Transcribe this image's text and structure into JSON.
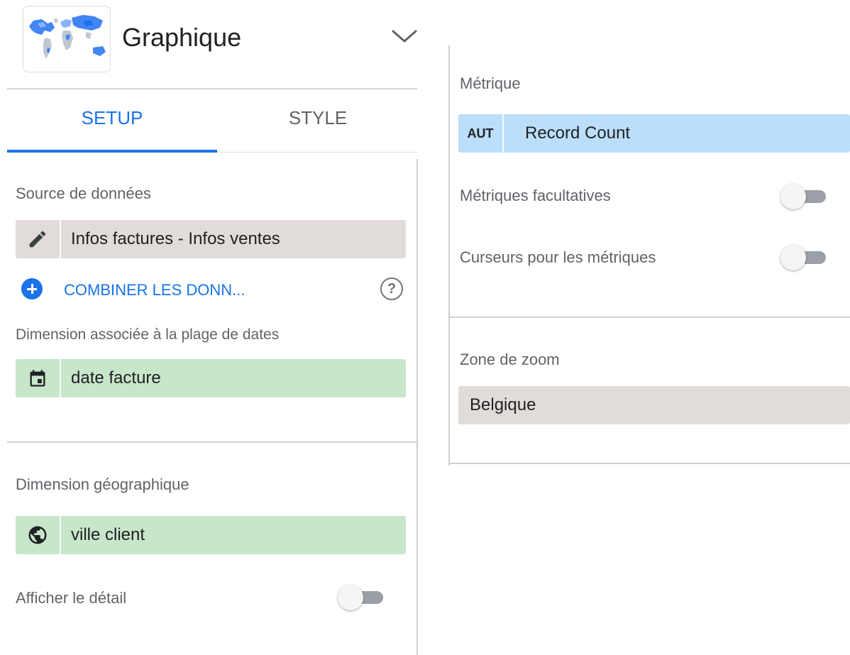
{
  "header": {
    "chart_title": "Graphique",
    "thumbnail_icon": "world-map-thumbnail",
    "dropdown_icon": "chevron-down-icon"
  },
  "tabs": [
    {
      "label": "SETUP",
      "active": true
    },
    {
      "label": "STYLE",
      "active": false
    }
  ],
  "data_source": {
    "label": "Source de données",
    "value": "Infos factures - Infos ventes",
    "icon": "pencil-icon"
  },
  "combine": {
    "label": "COMBINER LES DONN...",
    "icon": "plus-circle-icon",
    "help_icon": "help-circle-icon",
    "help_glyph": "?"
  },
  "date_range_dimension": {
    "label": "Dimension associée à la plage de dates",
    "value": "date facture",
    "icon": "calendar-icon"
  },
  "geo_dimension": {
    "label": "Dimension géographique",
    "value": "ville client",
    "icon": "globe-icon"
  },
  "drill_down": {
    "label": "Afficher le détail",
    "enabled": false
  },
  "metric": {
    "label": "Métrique",
    "aggregation": "AUT",
    "value": "Record Count"
  },
  "optional_metrics": {
    "label": "Métriques facultatives",
    "enabled": false
  },
  "metric_sliders": {
    "label": "Curseurs pour les métriques",
    "enabled": false
  },
  "zoom_area": {
    "label": "Zone de zoom",
    "value": "Belgique"
  },
  "colors": {
    "accent_blue": "#1a73e8",
    "chip_grey": "#e1dcd9",
    "chip_green": "#c8e6c9",
    "chip_metric_blue": "#bbdefb",
    "label_grey": "#5f6368",
    "toggle_track_off": "#9aa0a6"
  }
}
